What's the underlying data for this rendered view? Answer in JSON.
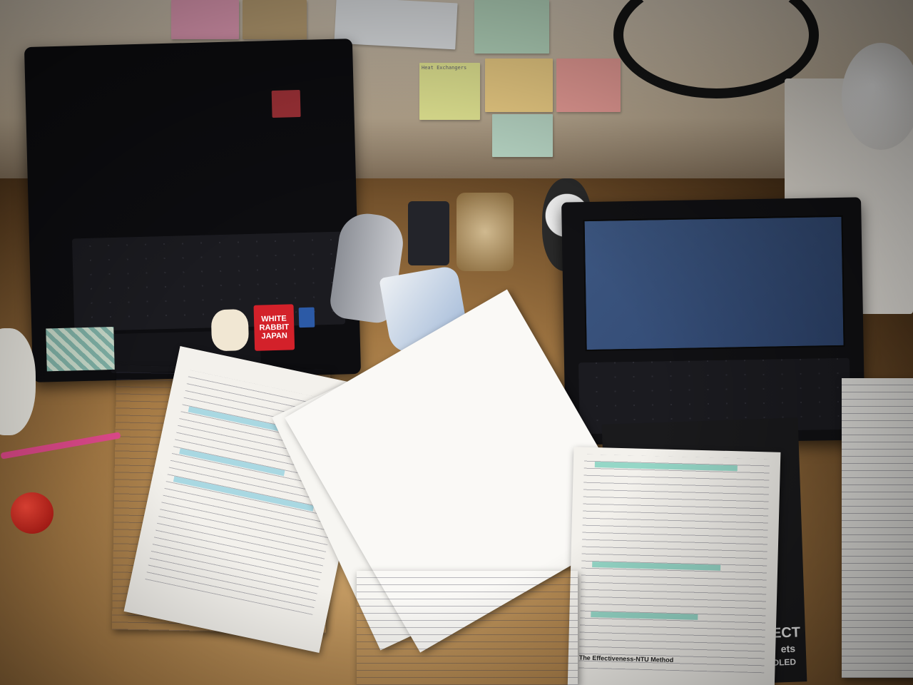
{
  "scene": {
    "stickers": {
      "white_rabbit_line1": "WHITE",
      "white_rabbit_line2": "RABBIT",
      "white_rabbit_line3": "JAPAN"
    },
    "notes": {
      "top_row_title": "Heat Exchangers",
      "yellow_note_text": "Heat Exchangers",
      "page_heading": "The Effectiveness-NTU Method"
    },
    "book_spine": {
      "text_line1": "ECT",
      "text_line2": "ets",
      "text_line3": "DLED"
    },
    "colors": {
      "desk": "#a57a45",
      "wall": "#d9cdbb",
      "screen": "#2f4670",
      "highlight": "#63c9b4",
      "sticker_red": "#d3212a"
    }
  }
}
